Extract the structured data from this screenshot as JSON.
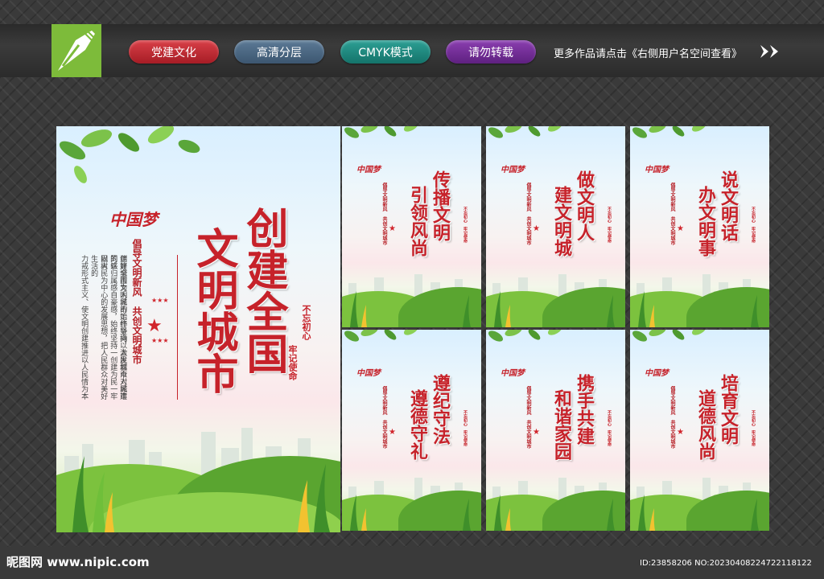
{
  "header": {
    "logo_icon": "pen-nib-icon",
    "tags": [
      "党建文化",
      "高清分层",
      "CMYK模式",
      "请勿转载"
    ],
    "promo_text": "更多作品请点击《右侧用户名空间查看》",
    "promo_icon": "double-chevron-right-icon"
  },
  "main_poster": {
    "brand": "中国梦",
    "title_col1": "创建全国",
    "title_col2": "文明城市",
    "subtitle": "倡导文明新风　共创文明城市",
    "seal_col1": "不忘初心",
    "seal_col2": "牢记使命",
    "body_col1": "创建全国文明城市始终坚持以人民城市人民建",
    "body_col2": "建好城市为人民的工作导向，激发群众对城市的认",
    "body_col3": "同感归属感自豪感，始终坚持一创建为民一牢固树",
    "body_col4": "以人民为中心的发展思想，把人民群众对美好生活的",
    "body_col5": "力戒形式主义、使文明创建推进以人民情为本"
  },
  "small_posters": [
    {
      "col1": "传播文明",
      "col2": "引领风尚"
    },
    {
      "col1": "做文明人",
      "col2": "建文明城"
    },
    {
      "col1": "说文明话",
      "col2": "办文明事"
    },
    {
      "col1": "遵纪守法",
      "col2": "遵德守礼"
    },
    {
      "col1": "携手共建",
      "col2": "和谐家园"
    },
    {
      "col1": "培育文明",
      "col2": "道德风尚"
    }
  ],
  "small_common": {
    "brand": "中国梦",
    "subtitle": "倡导文明新风　共创文明城市",
    "seal": "不忘初心　牢记使命"
  },
  "footer": {
    "watermark": "昵图网 www.nipic.com",
    "id_text": "ID:23858206 NO:20230408224722118122"
  }
}
